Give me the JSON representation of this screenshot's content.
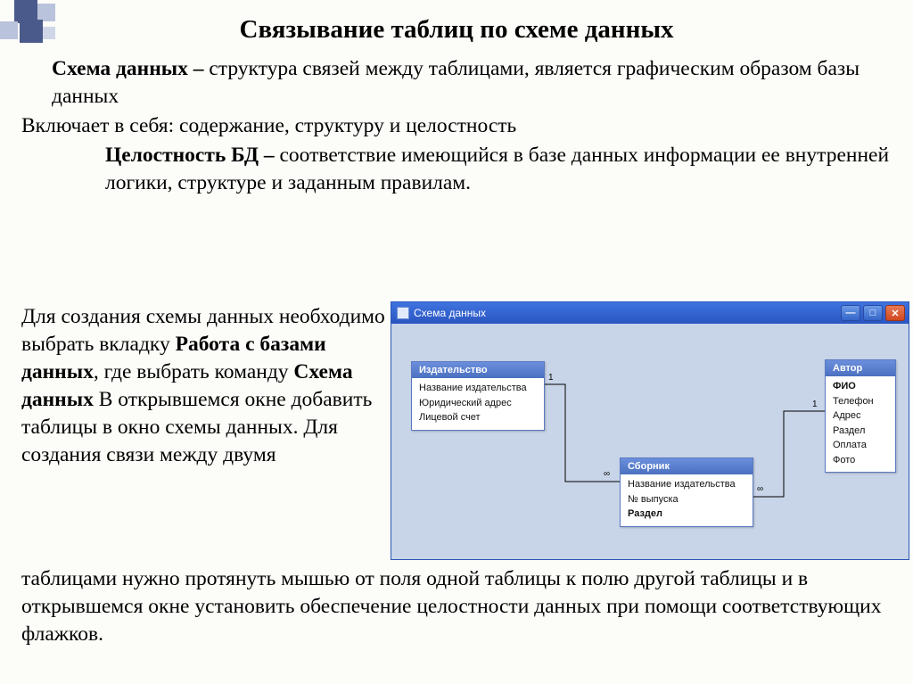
{
  "title": "Связывание таблиц по схеме данных",
  "def1_label": "Схема данных –",
  "def1_body": " структура связей между таблицами, является графическим образом базы данных",
  "includes": "Включает в себя: содержание, структуру и целостность",
  "def2_label": "Целостность БД –",
  "def2_body": " соответствие имеющийся в базе данных информации ее внутренней логики, структуре и заданным правилам.",
  "instr": {
    "p1a": "Для создания схемы данных необходимо выбрать вкладку ",
    "bold1": "Работа с базами данных",
    "p1b": ", где выбрать команду ",
    "bold2": "Схема данных",
    "p1c": " В открывшемся окне добавить таблицы в окно схемы данных. Для создания связи между двумя",
    "p2": " таблицами нужно протянуть мышью от поля одной таблицы к полю другой таблицы и в открывшемся окне установить обеспечение целостности данных при помощи соответствующих флажков."
  },
  "win": {
    "title": "Схема данных",
    "tables": {
      "t1": {
        "name": "Издательство",
        "fields": [
          "Название издательства",
          "Юридический адрес",
          "Лицевой счет"
        ]
      },
      "t2": {
        "name": "Сборник",
        "fields": [
          "Название издательства",
          "№ выпуска",
          "Раздел"
        ]
      },
      "t3": {
        "name": "Автор",
        "fields": [
          "ФИО",
          "Телефон",
          "Адрес",
          "Раздел",
          "Оплата",
          "Фото"
        ]
      }
    },
    "rel": {
      "one": "1",
      "many": "∞"
    }
  }
}
